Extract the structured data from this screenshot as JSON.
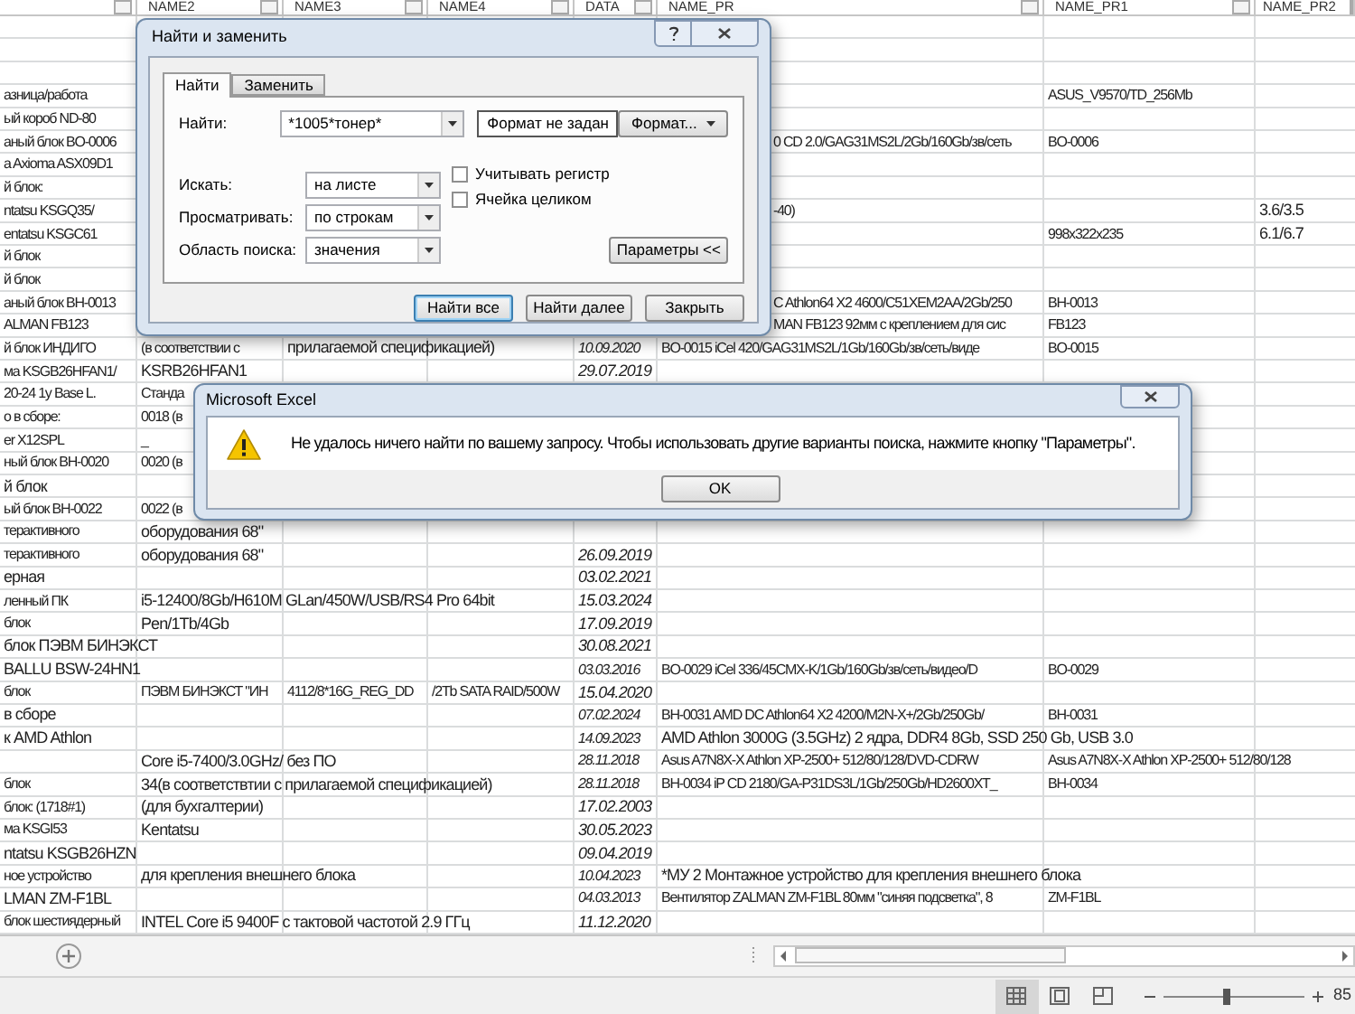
{
  "sheet": {
    "columns": [
      {
        "label": "NAME2"
      },
      {
        "label": "NAME3"
      },
      {
        "label": "NAME4"
      },
      {
        "label": "DATA"
      },
      {
        "label": "NAME_PR"
      },
      {
        "label": "NAME_PR1"
      },
      {
        "label": "NAME_PR2"
      }
    ],
    "rows": [
      {},
      {},
      {},
      {
        "A": "азница/работа",
        "G": "ASUS_V9570/TD_256Mb"
      },
      {
        "A": "ый короб ND-80"
      },
      {
        "A": "аный блок  BO-0006",
        "F": "0 CD 2.0/GAG31MS2L/2Gb/160Gb/зв/сеть",
        "G": "BO-0006"
      },
      {
        "A": "a Axioma ASX09D1"
      },
      {
        "A": "й блок:"
      },
      {
        "A": "ntatsu KSGQ35/",
        "F": "-40)",
        "H": "3.6/3.5"
      },
      {
        "A": "entatsu KSGC61",
        "G": "998x322x235",
        "H": "6.1/6.7"
      },
      {
        "A": "й блок"
      },
      {
        "A": "й блок"
      },
      {
        "A": "аный блок  BH-0013",
        "F": "C Athlon64 X2 4600/C51XEM2AA/2Gb/250",
        "G": "BH-0013"
      },
      {
        "A": "ALMAN FB123",
        "F": "MAN FB123 92мм  с креплением для сис",
        "G": "FB123"
      },
      {
        "A": "й блок  ИНДИГО",
        "B": "(в соответствии с",
        "C": "прилагаемой спецификацией)",
        "E": "10.09.2020",
        "F": "BO-0015 iCel 420/GAG31MS2L/1Gb/160Gb/зв/сеть/виде",
        "G": "BO-0015"
      },
      {
        "A": "ма KSGB26HFAN1/",
        "B": "KSRB26HFAN1",
        "E": "29.07.2019"
      },
      {
        "A": "20-24 1y Base L.",
        "B": "Станда"
      },
      {
        "A": "о в сборе:",
        "B": "0018 (в"
      },
      {
        "A": "er X12SPL",
        "B": "_"
      },
      {
        "A": "ный блок  BH-0020",
        "B": "0020 (в"
      },
      {
        "A": "й блок"
      },
      {
        "A": "ый блок  BH-0022",
        "B": "0022 (в"
      },
      {
        "A": "терактивного",
        "B": "оборудования 68\""
      },
      {
        "A": "терактивного",
        "B": "оборудования 68\"",
        "E": "26.09.2019"
      },
      {
        "A": "ерная",
        "E": "03.02.2021"
      },
      {
        "A": "ленный ПК",
        "B": "i5-12400/8Gb/H610M GLan/450W/USB/RS4 Pro 64bit",
        "E": "15.03.2024"
      },
      {
        "A": "блок",
        "B": "Pen/1Tb/4Gb",
        "E": "17.09.2019"
      },
      {
        "A": "блок ПЭВМ БИНЭКСТ",
        "E": "30.08.2021"
      },
      {
        "A": "BALLU BSW-24HN1",
        "E": "03.03.2016",
        "F": "BO-0029 iCel 336/45CMX-K/1Gb/160Gb/зв/сеть/видео/D",
        "G": "BO-0029"
      },
      {
        "A": "блок",
        "B": "ПЭВМ БИНЭКСТ \"ИН",
        "C": "4112/8*16G_REG_DD",
        "D": "/2Tb SATA RAID/500W",
        "E": "15.04.2020"
      },
      {
        "A": "в сборе",
        "E": "07.02.2024",
        "F": "BH-0031 AMD DC Athlon64 X2 4200/M2N-X+/2Gb/250Gb/",
        "G": "BH-0031"
      },
      {
        "A": "к AMD Athlon",
        "E": "14.09.2023",
        "F": "AMD Athlon 3000G (3.5GHz) 2 ядра, DDR4 8Gb, SSD 250 Gb, USB 3.0"
      },
      {
        "B": "Core i5-7400/3.0GHz/ без ПО",
        "E": "28.11.2018",
        "F": "Asus A7N8X-X Athlon XP-2500+ 512/80/128/DVD-CDRW",
        "G": "Asus A7N8X-X Athlon XP-2500+ 512/80/128"
      },
      {
        "A": "блок",
        "B": "34(в соответствтии с  прилагаемой спецификацией)",
        "E": "28.11.2018",
        "F": "BH-0034 iP CD 2180/GA-P31DS3L/1Gb/250Gb/HD2600XT_",
        "G": "BH-0034"
      },
      {
        "A": "блок:  (1718#1)",
        "B": "(для бухгалтерии)",
        "E": "17.02.2003"
      },
      {
        "A": "ма KSGI53",
        "B": "Kentatsu",
        "E": "30.05.2023"
      },
      {
        "A": "ntatsu KSGB26HZN",
        "E": "09.04.2019"
      },
      {
        "A": "ное устройство",
        "B": "для крепления внешнего блока",
        "E": "10.04.2023",
        "F": "*МУ 2 Монтажное устройство для крепления внешнего блока"
      },
      {
        "A": "LMAN ZM-F1BL",
        "E": "04.03.2013",
        "F": "Вентилятор ZALMAN ZM-F1BL 80мм \"синяя подсветка\", 8",
        "G": "ZM-F1BL"
      },
      {
        "A": "блок шестиядерный",
        "B": "INTEL Core i5 9400F с тактовой частотой 2.9 ГГц",
        "E": "11.12.2020"
      }
    ]
  },
  "find_dialog": {
    "title": "Найти и заменить",
    "tabs": [
      {
        "label": "Найти",
        "selected": true
      },
      {
        "label": "Заменить",
        "selected": false
      }
    ],
    "find": {
      "label": "Найти:",
      "value": "*1005*тонер*"
    },
    "format_preview": "Формат не задан",
    "format_button": "Формат...",
    "options": [
      {
        "label": "Искать:",
        "value": "на листе"
      },
      {
        "label": "Просматривать:",
        "value": "по строкам"
      },
      {
        "label": "Область поиска:",
        "value": "значения"
      }
    ],
    "checkboxes": [
      {
        "label": "Учитывать регистр",
        "checked": false
      },
      {
        "label": "Ячейка целиком",
        "checked": false
      }
    ],
    "options_button": "Параметры <<",
    "buttons": [
      {
        "label": "Найти все",
        "default": true
      },
      {
        "label": "Найти далее",
        "default": false
      },
      {
        "label": "Закрыть",
        "default": false
      }
    ]
  },
  "message_dialog": {
    "title": "Microsoft Excel",
    "message": "Не удалось ничего найти по вашему запросу. Чтобы использовать другие варианты поиска, нажмите кнопку \"Параметры\".",
    "button": "OK"
  },
  "status_bar": {
    "views": [
      {
        "kind": "normal",
        "selected": true
      },
      {
        "kind": "page_layout",
        "selected": false
      },
      {
        "kind": "page_break",
        "selected": false
      }
    ],
    "zoom_slider": {
      "level": 0.45
    },
    "zoom": "85"
  }
}
